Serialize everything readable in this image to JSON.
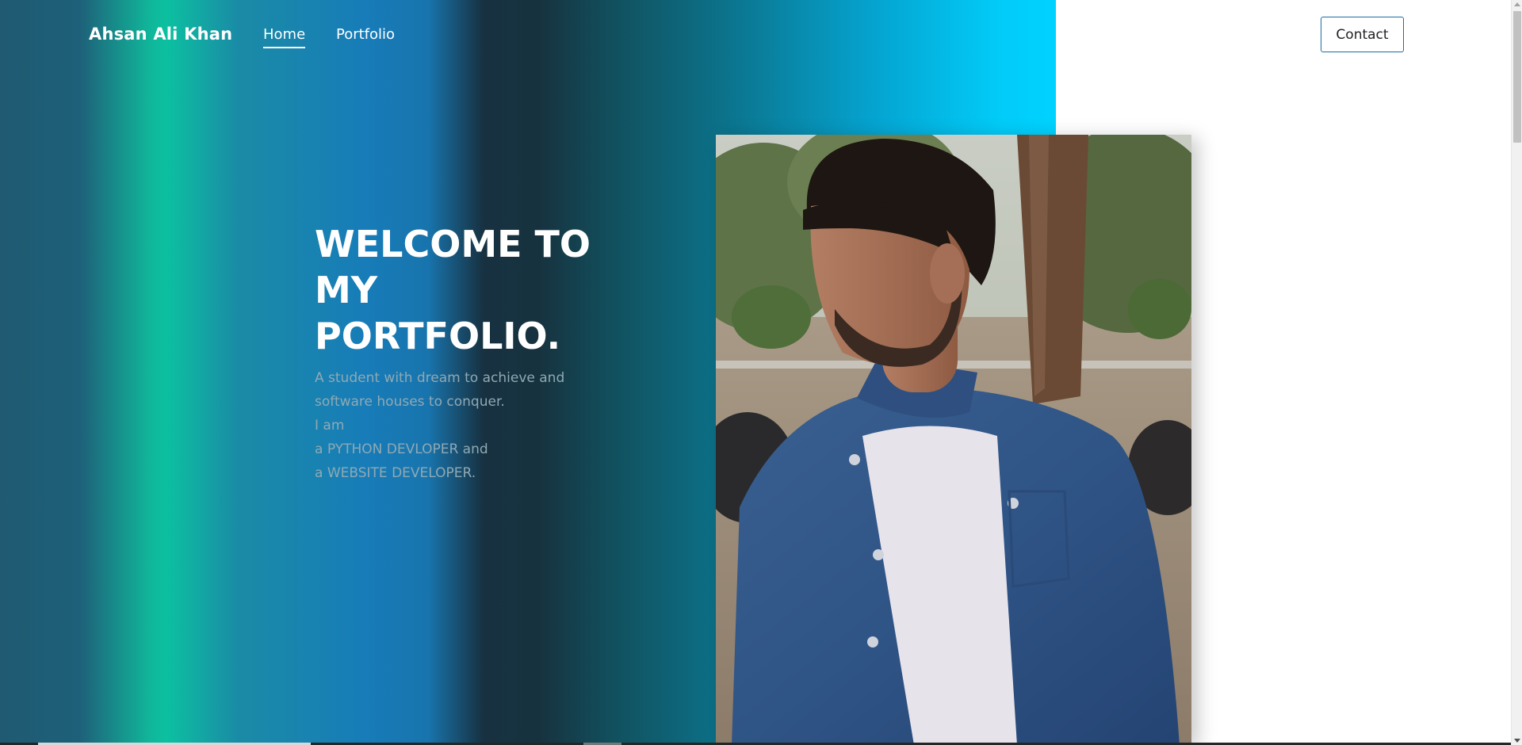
{
  "nav": {
    "brand": "Ahsan Ali Khan",
    "links": [
      {
        "label": "Home",
        "active": true
      },
      {
        "label": "Portfolio",
        "active": false
      }
    ],
    "contact_label": "Contact"
  },
  "hero": {
    "title_lines": [
      "WELCOME TO",
      "MY",
      "PORTFOLIO."
    ],
    "description_lines": [
      "A student with dream to achieve and",
      "software houses to conquer.",
      "I am",
      "a PYTHON DEVLOPER and",
      "a WEBSITE DEVELOPER."
    ]
  },
  "photo": {
    "subject": "portrait of a young man in a denim shirt outdoors"
  },
  "colors": {
    "accent": "#00d2ff",
    "teal": "#0cc0a0",
    "contact_border": "#1b6ea8",
    "desc_text": "#8fa9b4"
  }
}
